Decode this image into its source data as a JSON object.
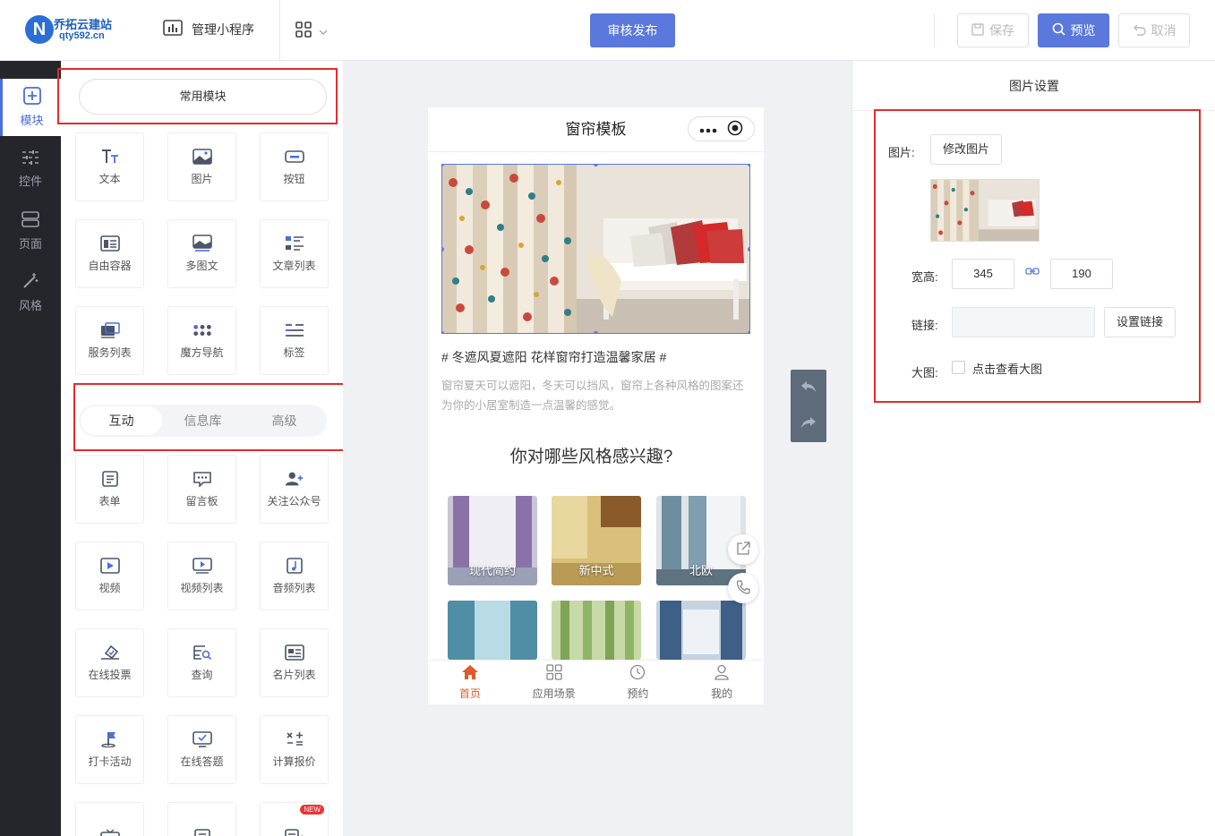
{
  "logo": {
    "mark": "N",
    "name": "乔拓云建站",
    "domain": "qty592.cn"
  },
  "topbar": {
    "manage_label": "管理小程序",
    "publish_label": "审核发布",
    "save_label": "保存",
    "preview_label": "预览",
    "cancel_label": "取消"
  },
  "leftnav": [
    {
      "label": "模块",
      "icon": "plus-square-icon",
      "active": true
    },
    {
      "label": "控件",
      "icon": "sliders-icon"
    },
    {
      "label": "页面",
      "icon": "pages-icon"
    },
    {
      "label": "风格",
      "icon": "magic-wand-icon"
    }
  ],
  "modules": {
    "common_label": "常用模块",
    "common": [
      {
        "label": "文本",
        "icon": "text-icon"
      },
      {
        "label": "图片",
        "icon": "image-icon"
      },
      {
        "label": "按钮",
        "icon": "button-icon"
      },
      {
        "label": "自由容器",
        "icon": "container-icon"
      },
      {
        "label": "多图文",
        "icon": "multi-image-icon"
      },
      {
        "label": "文章列表",
        "icon": "article-list-icon"
      },
      {
        "label": "服务列表",
        "icon": "service-list-icon"
      },
      {
        "label": "魔方导航",
        "icon": "cube-nav-icon"
      },
      {
        "label": "标签",
        "icon": "tag-icon"
      }
    ],
    "tabs": [
      "互动",
      "信息库",
      "高级"
    ],
    "interactive": [
      {
        "label": "表单",
        "icon": "form-icon"
      },
      {
        "label": "留言板",
        "icon": "message-board-icon"
      },
      {
        "label": "关注公众号",
        "icon": "follow-icon"
      },
      {
        "label": "视频",
        "icon": "video-icon"
      },
      {
        "label": "视频列表",
        "icon": "video-list-icon"
      },
      {
        "label": "音频列表",
        "icon": "audio-list-icon"
      },
      {
        "label": "在线投票",
        "icon": "vote-icon"
      },
      {
        "label": "查询",
        "icon": "query-icon"
      },
      {
        "label": "名片列表",
        "icon": "card-list-icon"
      },
      {
        "label": "打卡活动",
        "icon": "checkin-icon"
      },
      {
        "label": "在线答题",
        "icon": "quiz-icon"
      },
      {
        "label": "计算报价",
        "icon": "calculator-icon"
      }
    ],
    "new_badge": "NEW"
  },
  "phone": {
    "title": "窗帘模板",
    "article_title": "# 冬遮风夏遮阳 花样窗帘打造温馨家居 #",
    "article_desc": "窗帘夏天可以遮阳，冬天可以挡风，窗帘上各种风格的图案还为你的小居室制造一点温馨的感觉。",
    "question": "你对哪些风格感兴趣?",
    "categories": [
      "现代简约",
      "新中式",
      "北欧"
    ],
    "tabbar": [
      {
        "label": "首页",
        "icon": "home-icon",
        "active": true
      },
      {
        "label": "应用场景",
        "icon": "grid-icon"
      },
      {
        "label": "预约",
        "icon": "clock-icon"
      },
      {
        "label": "我的",
        "icon": "user-icon"
      }
    ]
  },
  "settings": {
    "title": "图片设置",
    "image_label": "图片:",
    "change_image": "修改图片",
    "size_label": "宽高:",
    "width": "345",
    "height": "190",
    "link_label": "链接:",
    "link_value": "",
    "set_link": "设置链接",
    "big_label": "大图:",
    "big_option": "点击查看大图"
  },
  "colors": {
    "accent": "#5b78dc",
    "highlight": "#e02d2d",
    "nav_bg": "#24262c",
    "tab_active": "#e05a2a"
  }
}
